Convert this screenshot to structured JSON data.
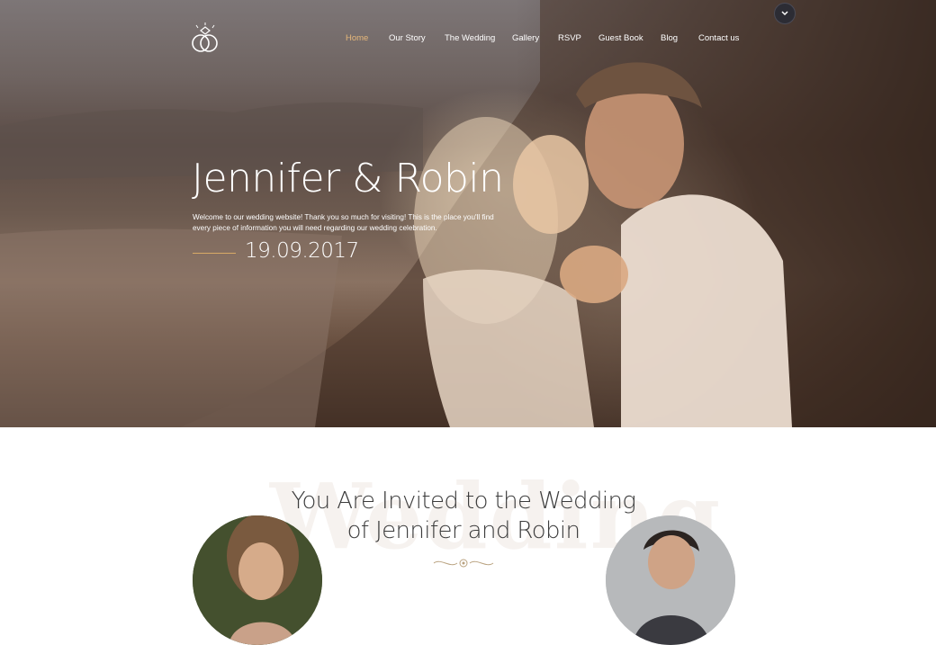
{
  "nav": {
    "items": [
      {
        "label": "Home",
        "active": true
      },
      {
        "label": "Our Story",
        "active": false
      },
      {
        "label": "The Wedding",
        "active": false
      },
      {
        "label": "Gallery",
        "active": false
      },
      {
        "label": "RSVP",
        "active": false
      },
      {
        "label": "Guest Book",
        "active": false
      },
      {
        "label": "Blog",
        "active": false
      },
      {
        "label": "Contact us",
        "active": false
      }
    ]
  },
  "logo": {
    "icon": "wedding-rings-icon"
  },
  "scroll_button": {
    "icon": "chevron-down-icon"
  },
  "hero": {
    "title": "Jennifer & Robin",
    "text": "Welcome to our wedding website! Thank you so much for visiting! This is the place you'll find every piece of information you will need regarding our wedding celebration.",
    "date": "19.09.2017"
  },
  "invite": {
    "watermark": "Wedding",
    "title_line1": "You Are Invited to the Wedding",
    "title_line2": "of Jennifer and Robin",
    "ornament": "flourish-divider-icon"
  },
  "colors": {
    "accent": "#e6b87a",
    "text_dark": "#3c3c3c",
    "white": "#ffffff"
  }
}
